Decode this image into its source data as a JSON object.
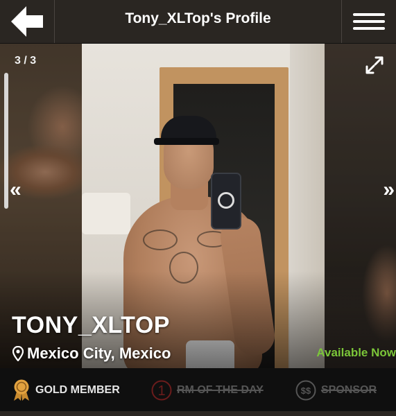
{
  "header": {
    "title": "Tony_XLTop's Profile",
    "back_icon": "arrow-left-icon",
    "menu_icon": "hamburger-menu-icon"
  },
  "gallery": {
    "counter": "3 / 3",
    "prev_glyph": "«",
    "next_glyph": "»",
    "expand_icon": "expand-icon"
  },
  "profile": {
    "username": "TONY_XLTOP",
    "location": "Mexico City, Mexico",
    "location_icon": "map-pin-icon",
    "availability": "Available Now",
    "availability_color": "#7bc639"
  },
  "badges": [
    {
      "icon": "gold-medal-icon",
      "label": "GOLD MEMBER",
      "active": true,
      "color": "#d59a3c"
    },
    {
      "icon": "number-one-icon",
      "label": "RM OF THE DAY",
      "active": false,
      "glyph": "1",
      "color": "#6b1c1c"
    },
    {
      "icon": "sponsor-dollar-icon",
      "label": "SPONSOR",
      "active": false,
      "glyph": "$$",
      "color": "#555555"
    }
  ]
}
